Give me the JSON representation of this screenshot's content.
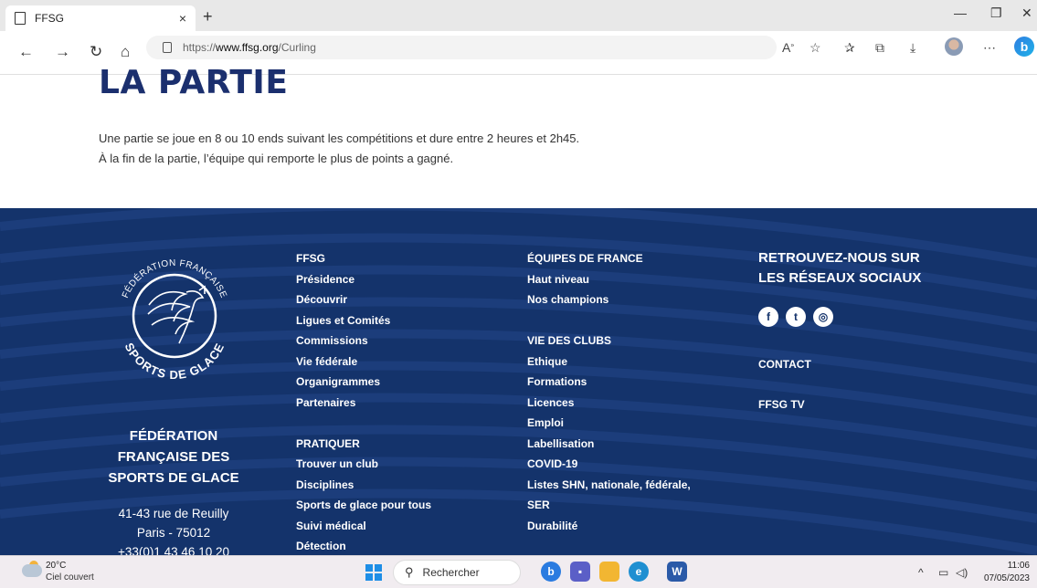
{
  "browser": {
    "tab_title": "FFSG",
    "tab_close": "×",
    "new_tab": "+",
    "url_prefix": "https://",
    "url_host": "www.ffsg.org",
    "url_path": "/Curling",
    "icons": [
      "back-icon",
      "forward-icon",
      "refresh-icon",
      "home-icon",
      "read-aloud-icon",
      "add-favorite-icon",
      "favorites-icon",
      "collections-icon",
      "downloads-icon",
      "profile-avatar",
      "more-icon",
      "bing-icon"
    ]
  },
  "page": {
    "title": "LA PARTIE",
    "paragraph_1": "Une partie se joue en 8 ou 10 ends suivant les compétitions et dure entre 2 heures et 2h45.",
    "paragraph_2": "À la fin de la partie, l’équipe qui remporte le plus de points a gagné."
  },
  "footer": {
    "logo_text_top": "FÉDÉRATION FRANÇAISE",
    "logo_text_bottom": "SPORTS DE GLACE",
    "federation_name": [
      "FÉDÉRATION",
      "FRANÇAISE DES",
      "SPORTS DE GLACE"
    ],
    "address": [
      "41-43 rue de Reuilly",
      "Paris - 75012",
      "+33(0)1 43 46 10 20"
    ],
    "col1": {
      "head1": "FFSG",
      "links1": [
        "Présidence",
        "Découvrir",
        "Ligues et Comités",
        "Commissions",
        "Vie fédérale",
        "Organigrammes",
        "Partenaires"
      ],
      "head2": "PRATIQUER",
      "links2": [
        "Trouver un club",
        "Disciplines",
        "Sports de glace pour tous",
        "Suivi médical",
        "Détection"
      ]
    },
    "col2": {
      "head1": "ÉQUIPES DE FRANCE",
      "links1": [
        "Haut niveau",
        "Nos champions"
      ],
      "head2": "VIE DES CLUBS",
      "links2": [
        "Ethique",
        "Formations",
        "Licences",
        "Emploi",
        "Labellisation",
        "COVID-19",
        "Listes SHN, nationale, fédérale,",
        "SER",
        "Durabilité"
      ]
    },
    "social_title": [
      "RETROUVEZ-NOUS SUR",
      "LES RÉSEAUX SOCIAUX"
    ],
    "social_icons": [
      "facebook-icon",
      "twitter-icon",
      "instagram-icon"
    ],
    "contact": "CONTACT",
    "tv": "FFSG TV",
    "colors": {
      "background": "#14336b",
      "title": "#1b2f6e"
    }
  },
  "taskbar": {
    "temperature": "20°C",
    "weather": "Ciel couvert",
    "search_placeholder": "Rechercher",
    "time": "11:06",
    "date": "07/05/2023"
  }
}
